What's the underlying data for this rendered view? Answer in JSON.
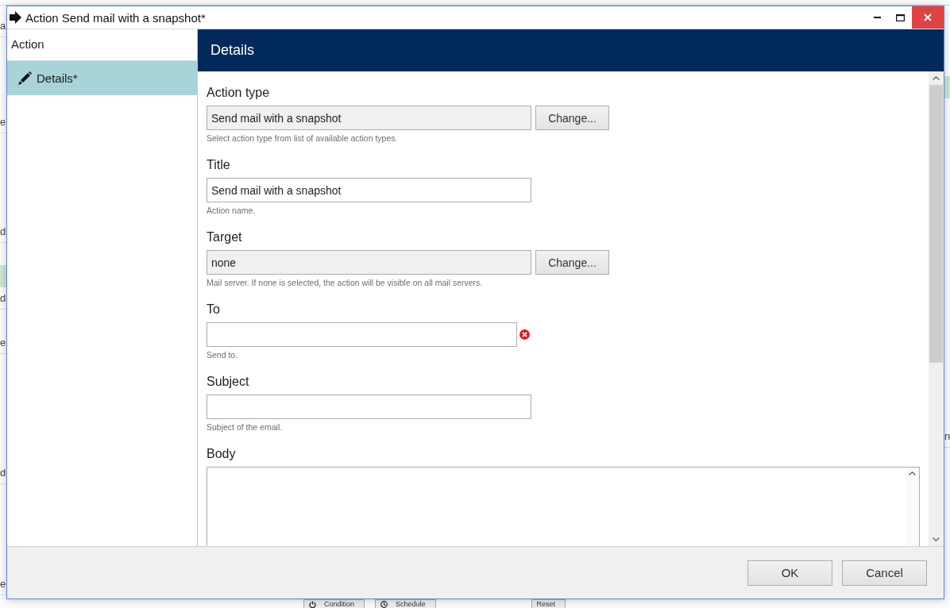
{
  "background_window": {
    "left_rows": [
      {
        "text": "a",
        "selected": false
      },
      {
        "text": "e",
        "selected": false
      },
      {
        "text": "d",
        "selected": false
      },
      {
        "selected": true
      },
      {
        "text": "d",
        "selected": false
      },
      {
        "text": "e",
        "selected": false
      },
      {
        "text": "d",
        "selected": false
      },
      {
        "text": "e",
        "selected": false
      }
    ],
    "right_rows": [
      {
        "selected": true
      },
      {
        "text": "n",
        "selected": false
      }
    ],
    "buttons": [
      {
        "label": "Condition"
      },
      {
        "label": "Schedule"
      },
      {
        "label": "Reset"
      }
    ]
  },
  "window": {
    "title": "Action Send mail with a snapshot*"
  },
  "sidebar": {
    "heading": "Action",
    "items": [
      {
        "label": "Details*",
        "selected": true
      }
    ]
  },
  "panel": {
    "title": "Details"
  },
  "form": {
    "fields": [
      {
        "kind": "readonly",
        "label": "Action type",
        "value": "Send mail with a snapshot",
        "button": "Change...",
        "help": "Select action type from list of available action types.",
        "error": false
      },
      {
        "kind": "text",
        "label": "Title",
        "value": "Send mail with a snapshot",
        "help": "Action name.",
        "error": false
      },
      {
        "kind": "readonly",
        "label": "Target",
        "value": "none",
        "button": "Change...",
        "help": "Mail server. If none is selected, the action will be visible on all mail servers.",
        "error": false
      },
      {
        "kind": "text",
        "label": "To",
        "help": "Send to.",
        "error": true
      },
      {
        "kind": "text",
        "label": "Subject",
        "help": "Subject of the email.",
        "error": false
      },
      {
        "kind": "textarea",
        "label": "Body",
        "error": false
      }
    ]
  },
  "buttons": [
    {
      "label": "OK"
    },
    {
      "label": "Cancel"
    }
  ]
}
